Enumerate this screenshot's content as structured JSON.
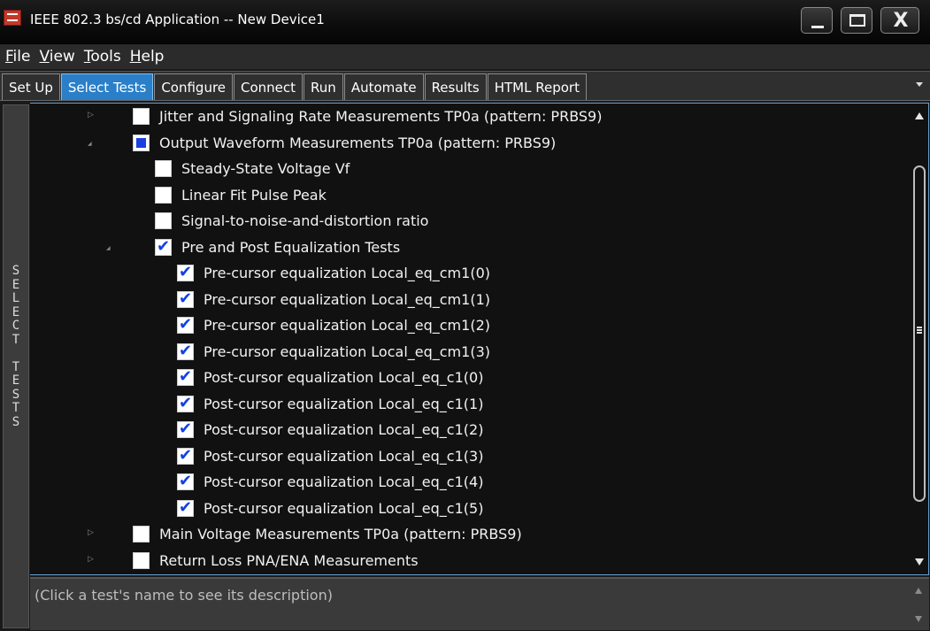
{
  "window": {
    "title": "IEEE 802.3 bs/cd Application -- New Device1",
    "icon": "app-logo-icon"
  },
  "menu": [
    "File",
    "View",
    "Tools",
    "Help"
  ],
  "tabs": [
    {
      "label": "Set Up",
      "active": false
    },
    {
      "label": "Select Tests",
      "active": true
    },
    {
      "label": "Configure",
      "active": false
    },
    {
      "label": "Connect",
      "active": false
    },
    {
      "label": "Run",
      "active": false
    },
    {
      "label": "Automate",
      "active": false
    },
    {
      "label": "Results",
      "active": false
    },
    {
      "label": "HTML Report",
      "active": false
    }
  ],
  "side_label": "SELECT TESTS",
  "tree": [
    {
      "label": "Jitter and Signaling Rate Measurements TP0a (pattern: PRBS9)",
      "level": 0,
      "state": "unchecked",
      "expander": "collapsed"
    },
    {
      "label": "Output Waveform Measurements TP0a (pattern: PRBS9)",
      "level": 0,
      "state": "partial",
      "expander": "expanded"
    },
    {
      "label": "Steady-State Voltage Vf",
      "level": 1,
      "state": "unchecked",
      "expander": "none"
    },
    {
      "label": "Linear Fit Pulse Peak",
      "level": 1,
      "state": "unchecked",
      "expander": "none"
    },
    {
      "label": "Signal-to-noise-and-distortion ratio",
      "level": 1,
      "state": "unchecked",
      "expander": "none"
    },
    {
      "label": "Pre and Post Equalization Tests",
      "level": 1,
      "state": "checked",
      "expander": "expanded"
    },
    {
      "label": "Pre-cursor equalization Local_eq_cm1(0)",
      "level": 2,
      "state": "checked",
      "expander": "none"
    },
    {
      "label": "Pre-cursor equalization Local_eq_cm1(1)",
      "level": 2,
      "state": "checked",
      "expander": "none"
    },
    {
      "label": "Pre-cursor equalization Local_eq_cm1(2)",
      "level": 2,
      "state": "checked",
      "expander": "none"
    },
    {
      "label": "Pre-cursor equalization Local_eq_cm1(3)",
      "level": 2,
      "state": "checked",
      "expander": "none"
    },
    {
      "label": "Post-cursor equalization Local_eq_c1(0)",
      "level": 2,
      "state": "checked",
      "expander": "none"
    },
    {
      "label": "Post-cursor equalization Local_eq_c1(1)",
      "level": 2,
      "state": "checked",
      "expander": "none"
    },
    {
      "label": "Post-cursor equalization Local_eq_c1(2)",
      "level": 2,
      "state": "checked",
      "expander": "none"
    },
    {
      "label": "Post-cursor equalization Local_eq_c1(3)",
      "level": 2,
      "state": "checked",
      "expander": "none"
    },
    {
      "label": "Post-cursor equalization Local_eq_c1(4)",
      "level": 2,
      "state": "checked",
      "expander": "none"
    },
    {
      "label": "Post-cursor equalization Local_eq_c1(5)",
      "level": 2,
      "state": "checked",
      "expander": "none"
    },
    {
      "label": "Main Voltage Measurements TP0a (pattern: PRBS9)",
      "level": 0,
      "state": "unchecked",
      "expander": "collapsed"
    },
    {
      "label": "Return Loss PNA/ENA Measurements",
      "level": 0,
      "state": "unchecked",
      "expander": "collapsed"
    }
  ],
  "description": "(Click a test's name to see its description)",
  "colors": {
    "active_tab": "#2a7fc8",
    "checkmark": "#1340e0",
    "partial": "#1b3fe0"
  }
}
